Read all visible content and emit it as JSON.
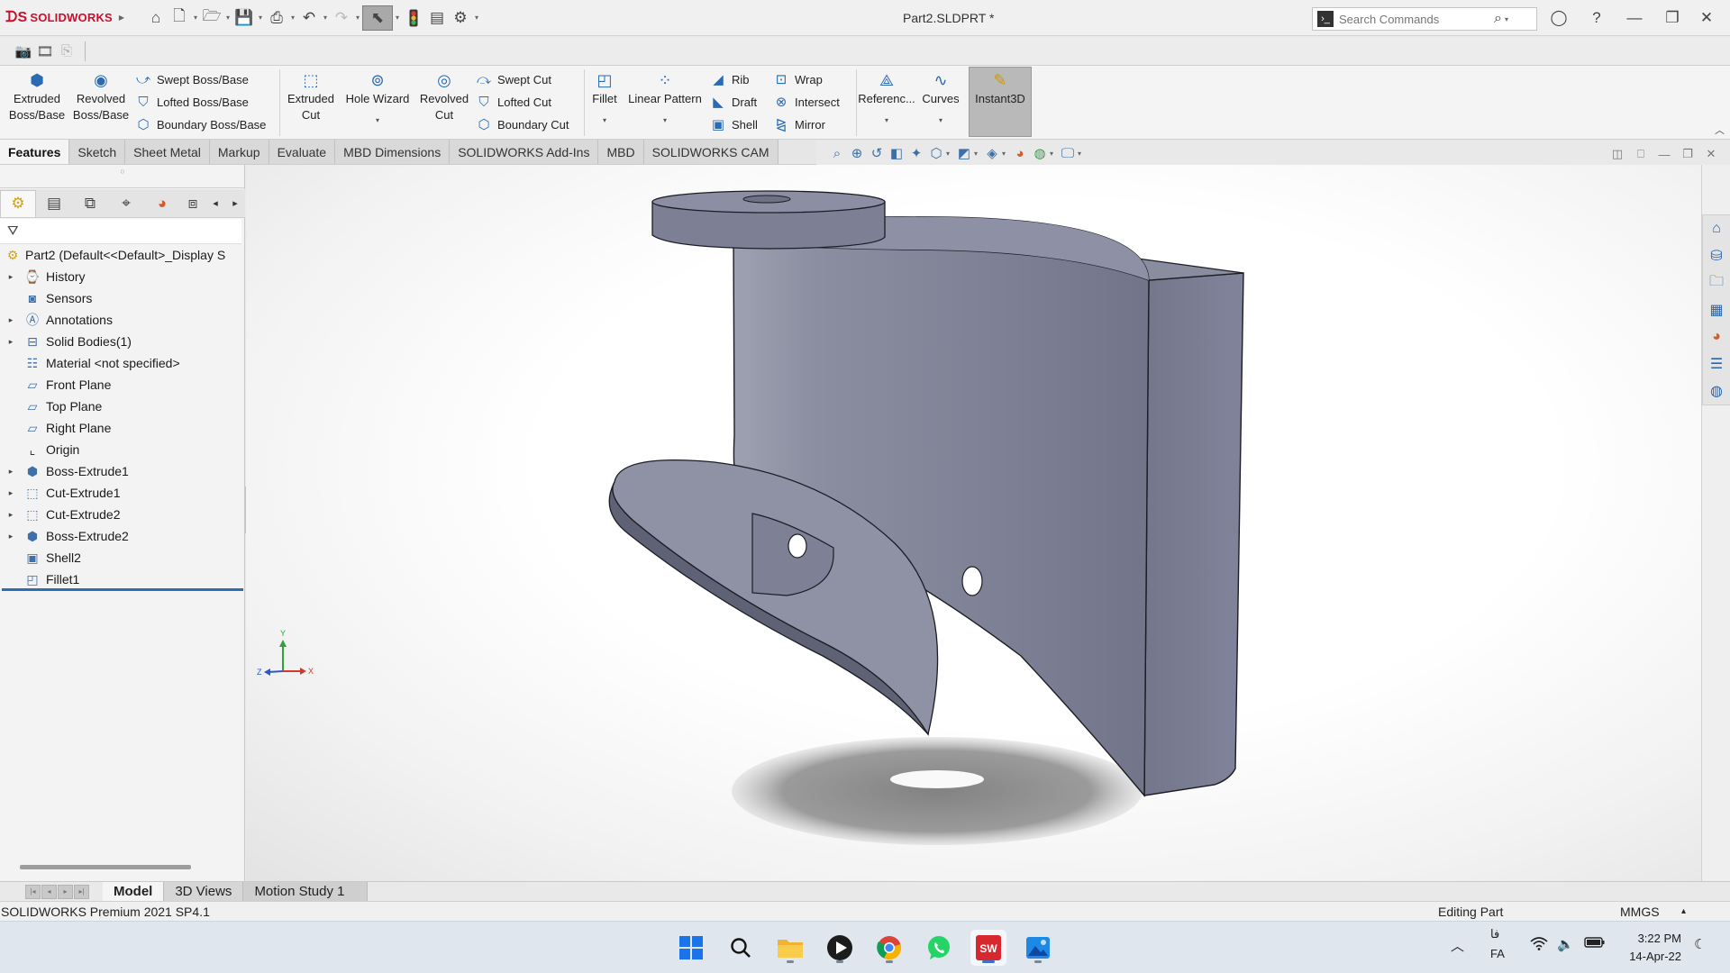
{
  "app": {
    "brand": "SOLIDWORKS",
    "document_title": "Part2.SLDPRT *",
    "search_placeholder": "Search Commands"
  },
  "command_manager": {
    "extruded_boss": "Extruded Boss/Base",
    "revolved_boss": "Revolved Boss/Base",
    "swept_boss": "Swept Boss/Base",
    "lofted_boss": "Lofted Boss/Base",
    "boundary_boss": "Boundary Boss/Base",
    "extruded_cut": "Extruded Cut",
    "hole_wizard": "Hole Wizard",
    "revolved_cut": "Revolved Cut",
    "swept_cut": "Swept Cut",
    "lofted_cut": "Lofted Cut",
    "boundary_cut": "Boundary Cut",
    "fillet": "Fillet",
    "linear_pattern": "Linear Pattern",
    "rib": "Rib",
    "draft": "Draft",
    "shell": "Shell",
    "wrap": "Wrap",
    "intersect": "Intersect",
    "mirror": "Mirror",
    "reference": "Referenc...",
    "curves": "Curves",
    "instant3d": "Instant3D"
  },
  "tabs": [
    "Features",
    "Sketch",
    "Sheet Metal",
    "Markup",
    "Evaluate",
    "MBD Dimensions",
    "SOLIDWORKS Add-Ins",
    "MBD",
    "SOLIDWORKS CAM"
  ],
  "active_tab": "Features",
  "feature_tree": {
    "root": "Part2  (Default<<Default>_Display S",
    "items": [
      {
        "label": "History",
        "icon": "history-icon"
      },
      {
        "label": "Sensors",
        "icon": "sensors-icon"
      },
      {
        "label": "Annotations",
        "icon": "annotations-icon"
      },
      {
        "label": "Solid Bodies(1)",
        "icon": "solid-bodies-icon"
      },
      {
        "label": "Material <not specified>",
        "icon": "material-icon"
      },
      {
        "label": "Front Plane",
        "icon": "plane-icon"
      },
      {
        "label": "Top Plane",
        "icon": "plane-icon"
      },
      {
        "label": "Right Plane",
        "icon": "plane-icon"
      },
      {
        "label": "Origin",
        "icon": "origin-icon"
      },
      {
        "label": "Boss-Extrude1",
        "icon": "boss-extrude-icon"
      },
      {
        "label": "Cut-Extrude1",
        "icon": "cut-extrude-icon"
      },
      {
        "label": "Cut-Extrude2",
        "icon": "cut-extrude-icon"
      },
      {
        "label": "Boss-Extrude2",
        "icon": "boss-extrude-icon"
      },
      {
        "label": "Shell2",
        "icon": "shell-icon"
      },
      {
        "label": "Fillet1",
        "icon": "fillet-icon"
      }
    ]
  },
  "triad": {
    "x": "X",
    "y": "Y",
    "z": "Z"
  },
  "bottom_tabs": [
    "Model",
    "3D Views",
    "Motion Study 1"
  ],
  "status": {
    "product": "SOLIDWORKS Premium 2021 SP4.1",
    "mode": "Editing Part",
    "units": "MMGS"
  },
  "taskbar": {
    "apps": [
      "start-icon",
      "search-icon",
      "file-explorer-icon",
      "media-player-icon",
      "chrome-icon",
      "whatsapp-icon",
      "solidworks-icon",
      "photos-icon"
    ],
    "language_top": "فا",
    "language_bottom": "FA",
    "time": "3:22 PM",
    "date": "14-Apr-22"
  },
  "colors": {
    "accent": "#2c6fb0",
    "brand_red": "#c8102e",
    "model_face": "#7f8397"
  }
}
